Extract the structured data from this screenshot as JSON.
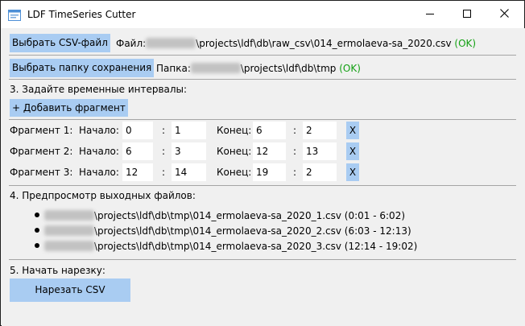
{
  "window": {
    "title": "LDF TimeSeries Cutter"
  },
  "icons": {
    "app": "app-window-icon",
    "minimize": "minimize-icon",
    "maximize": "maximize-icon",
    "close": "close-icon"
  },
  "colors": {
    "button": "#a9ccf2",
    "ok": "#12a012",
    "separator": "#a5a5a5"
  },
  "csv": {
    "button_label": "Выбрать CSV-файл",
    "file_label": "Файл:",
    "path": "\\projects\\ldf\\db\\raw_csv\\014_ermolaeva-sa_2020.csv",
    "status": "(OK)"
  },
  "save": {
    "button_label": "Выбрать папку сохранения",
    "folder_label": "Папка:",
    "path": "\\projects\\ldf\\db\\tmp",
    "status": "(OK)"
  },
  "intervals": {
    "heading": "3. Задайте временные интервалы:",
    "add_label": "+ Добавить фрагмент",
    "start_label": "Начало:",
    "end_label": "Конец:",
    "colon": ":",
    "delete_label": "X",
    "fragments": [
      {
        "label": "Фрагмент 1:",
        "start_min": "0",
        "start_sec": "1",
        "end_min": "6",
        "end_sec": "2"
      },
      {
        "label": "Фрагмент 2:",
        "start_min": "6",
        "start_sec": "3",
        "end_min": "12",
        "end_sec": "13"
      },
      {
        "label": "Фрагмент 3:",
        "start_min": "12",
        "start_sec": "14",
        "end_min": "19",
        "end_sec": "2"
      }
    ]
  },
  "preview": {
    "heading": "4. Предпросмотр выходных файлов:",
    "files": [
      "\\projects\\ldf\\db\\tmp\\014_ermolaeva-sa_2020_1.csv (0:01 - 6:02)",
      "\\projects\\ldf\\db\\tmp\\014_ermolaeva-sa_2020_2.csv (6:03 - 12:13)",
      "\\projects\\ldf\\db\\tmp\\014_ermolaeva-sa_2020_3.csv (12:14 - 19:02)"
    ]
  },
  "cut": {
    "heading": "5. Начать нарезку:",
    "button_label": "Нарезать CSV"
  }
}
